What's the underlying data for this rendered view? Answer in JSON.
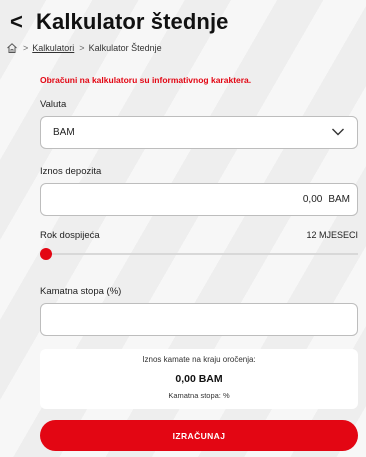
{
  "header": {
    "back_icon": "chevron-left-icon",
    "back_label": "<",
    "title": "Kalkulator štednje"
  },
  "breadcrumb": {
    "home_icon": "home-icon",
    "separator": ">",
    "link": "Kalkulatori",
    "current": "Kalkulator Štednje"
  },
  "notice": "Obračuni na kalkulatoru su informativnog karaktera.",
  "valuta": {
    "label": "Valuta",
    "value": "BAM"
  },
  "iznos": {
    "label": "Iznos depozita",
    "value": "0,00",
    "currency": "BAM"
  },
  "rok": {
    "label": "Rok dospijeća",
    "value": "12 MJESECI",
    "slider_position": 0
  },
  "kamatna": {
    "label": "Kamatna stopa (%)",
    "value": ""
  },
  "result": {
    "label": "Iznos kamate na kraju oročenja:",
    "amount": "0,00 BAM",
    "rate": "Kamatna stopa: %"
  },
  "button": {
    "label": "IZRAČUNAJ"
  },
  "colors": {
    "accent": "#e30613",
    "text": "#1f1f1f"
  }
}
